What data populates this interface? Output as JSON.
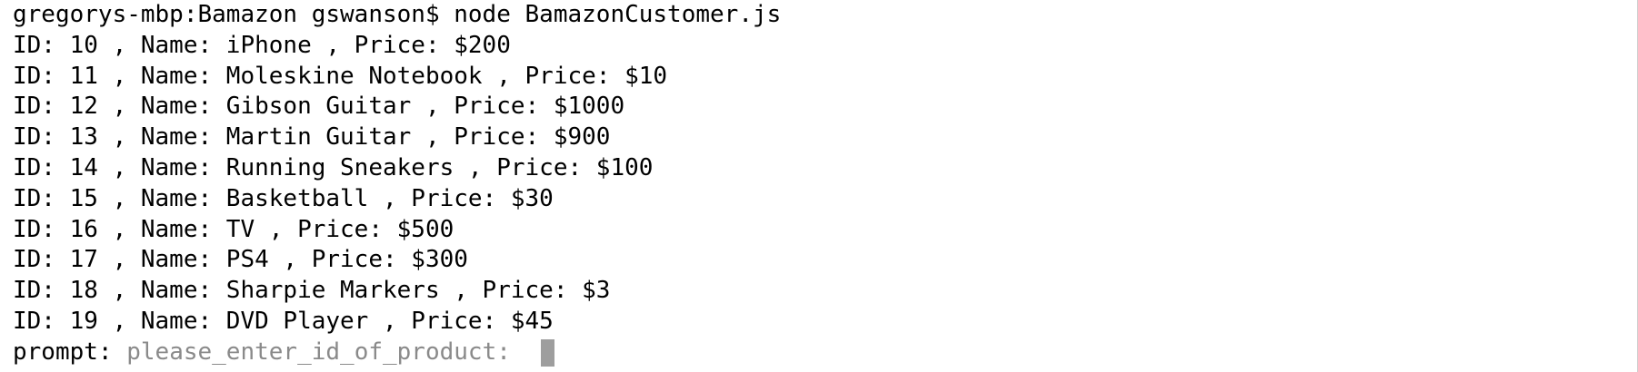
{
  "terminal": {
    "command_line": "gregorys-mbp:Bamazon gswanson$ node BamazonCustomer.js",
    "output_lines": [
      "ID: 10 , Name: iPhone , Price: $200",
      "ID: 11 , Name: Moleskine Notebook , Price: $10",
      "ID: 12 , Name: Gibson Guitar , Price: $1000",
      "ID: 13 , Name: Martin Guitar , Price: $900",
      "ID: 14 , Name: Running Sneakers , Price: $100",
      "ID: 15 , Name: Basketball , Price: $30",
      "ID: 16 , Name: TV , Price: $500",
      "ID: 17 , Name: PS4 , Price: $300",
      "ID: 18 , Name: Sharpie Markers , Price: $3",
      "ID: 19 , Name: DVD Player , Price: $45"
    ],
    "prompt": {
      "label": "prompt: ",
      "message": "please_enter_id_of_product:  "
    }
  },
  "colors": {
    "background": "#ffffff",
    "text": "#000000",
    "prompt_message": "#8a8a8a",
    "cursor": "#9e9e9e"
  }
}
